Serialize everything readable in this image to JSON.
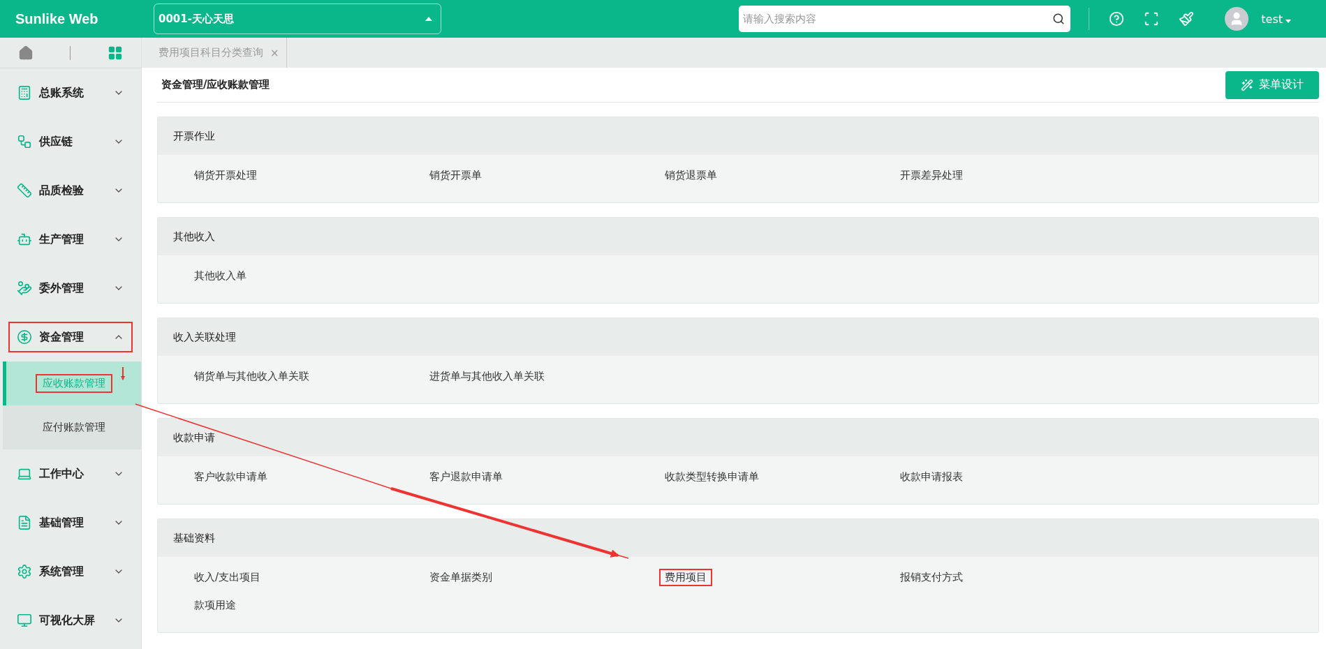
{
  "header": {
    "logo": "Sunlike Web",
    "company": "0001-天心天思",
    "search": {
      "placeholder": "请输入搜索内容"
    },
    "user": "test"
  },
  "tabs": [
    {
      "label": "费用项目科目分类查询",
      "close": "×"
    }
  ],
  "sidebar": {
    "items": [
      {
        "label": "总账系统",
        "expanded": false,
        "annotated": false
      },
      {
        "label": "供应链",
        "expanded": false,
        "annotated": false
      },
      {
        "label": "品质检验",
        "expanded": false,
        "annotated": false
      },
      {
        "label": "生产管理",
        "expanded": false,
        "annotated": false
      },
      {
        "label": "委外管理",
        "expanded": false,
        "annotated": false
      },
      {
        "label": "资金管理",
        "expanded": true,
        "annotated": true,
        "children": [
          {
            "label": "应收账款管理",
            "selected": true,
            "annotated": true
          },
          {
            "label": "应付账款管理",
            "selected": false,
            "annotated": false
          }
        ]
      },
      {
        "label": "工作中心",
        "expanded": false,
        "annotated": false
      },
      {
        "label": "基础管理",
        "expanded": false,
        "annotated": false
      },
      {
        "label": "系统管理",
        "expanded": false,
        "annotated": false
      },
      {
        "label": "可视化大屏",
        "expanded": false,
        "annotated": false
      }
    ]
  },
  "breadcrumb": "资金管理/应收账款管理",
  "design_button": "菜单设计",
  "sections": [
    {
      "title": "开票作业",
      "items": [
        {
          "label": "销货开票处理",
          "annotated": false
        },
        {
          "label": "销货开票单",
          "annotated": false
        },
        {
          "label": "销货退票单",
          "annotated": false
        },
        {
          "label": "开票差异处理",
          "annotated": false
        }
      ]
    },
    {
      "title": "其他收入",
      "items": [
        {
          "label": "其他收入单",
          "annotated": false
        }
      ]
    },
    {
      "title": "收入关联处理",
      "items": [
        {
          "label": "销货单与其他收入单关联",
          "annotated": false
        },
        {
          "label": "进货单与其他收入单关联",
          "annotated": false
        }
      ]
    },
    {
      "title": "收款申请",
      "items": [
        {
          "label": "客户收款申请单",
          "annotated": false
        },
        {
          "label": "客户退款申请单",
          "annotated": false
        },
        {
          "label": "收款类型转换申请单",
          "annotated": false
        },
        {
          "label": "收款申请报表",
          "annotated": false
        }
      ]
    },
    {
      "title": "基础资料",
      "items": [
        {
          "label": "收入/支出项目",
          "annotated": false
        },
        {
          "label": "资金单据类别",
          "annotated": false
        },
        {
          "label": "费用项目",
          "annotated": true
        },
        {
          "label": "报销支付方式",
          "annotated": false
        },
        {
          "label": "款项用途",
          "annotated": false
        }
      ]
    }
  ]
}
